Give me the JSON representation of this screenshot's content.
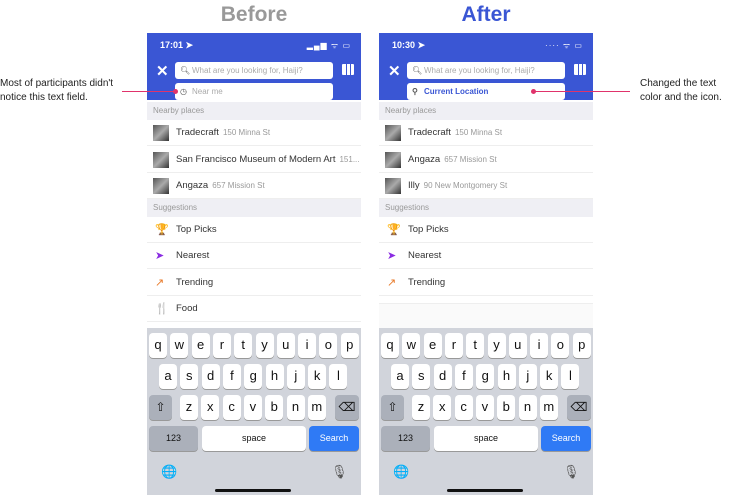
{
  "colors": {
    "header": "#3a56d4",
    "accent": "#e0336b",
    "after_title": "#3a56d4",
    "before_title": "#999999",
    "location_text": "#3a56d4"
  },
  "before": {
    "title": "Before",
    "time": "17:01 ➤",
    "status": "▂▄▆ ᯤ ▭",
    "search_placeholder": "What are you looking for, Haiji?",
    "location_text": "Near me",
    "location_icon": "clock-icon",
    "nearby_label": "Nearby places",
    "nearby": [
      {
        "name": "Tradecraft",
        "addr": "150 Minna St"
      },
      {
        "name": "San Francisco Museum of Modern Art",
        "addr": "151..."
      },
      {
        "name": "Angaza",
        "addr": "657 Mission St"
      }
    ],
    "suggestions_label": "Suggestions",
    "suggestions": [
      {
        "label": "Top Picks",
        "icon": "trophy-icon",
        "glyph": "🏆",
        "color": "#e0446b"
      },
      {
        "label": "Nearest",
        "icon": "location-arrow-icon",
        "glyph": "➤",
        "color": "#8a2be2"
      },
      {
        "label": "Trending",
        "icon": "trending-icon",
        "glyph": "↗",
        "color": "#e87a2a"
      },
      {
        "label": "Food",
        "icon": "fork-knife-icon",
        "glyph": "🍴",
        "color": "#2c46b8"
      }
    ]
  },
  "after": {
    "title": "After",
    "time": "10:30 ➤",
    "status": "···· ᯤ ▭",
    "search_placeholder": "What are you looking for, Haiji?",
    "location_text": "Current Location",
    "location_icon": "pin-icon",
    "nearby_label": "Nearby places",
    "nearby": [
      {
        "name": "Tradecraft",
        "addr": "150 Minna St"
      },
      {
        "name": "Angaza",
        "addr": "657 Mission St"
      },
      {
        "name": "Illy",
        "addr": "90 New Montgomery St"
      }
    ],
    "suggestions_label": "Suggestions",
    "suggestions": [
      {
        "label": "Top Picks",
        "icon": "trophy-icon",
        "glyph": "🏆",
        "color": "#e0446b"
      },
      {
        "label": "Nearest",
        "icon": "location-arrow-icon",
        "glyph": "➤",
        "color": "#8a2be2"
      },
      {
        "label": "Trending",
        "icon": "trending-icon",
        "glyph": "↗",
        "color": "#e87a2a"
      }
    ]
  },
  "keyboard": {
    "row1": [
      "q",
      "w",
      "e",
      "r",
      "t",
      "y",
      "u",
      "i",
      "o",
      "p"
    ],
    "row2": [
      "a",
      "s",
      "d",
      "f",
      "g",
      "h",
      "j",
      "k",
      "l"
    ],
    "row3": [
      "z",
      "x",
      "c",
      "v",
      "b",
      "n",
      "m"
    ],
    "shift": "⇧",
    "delete": "⌫",
    "numbers": "123",
    "space": "space",
    "search": "Search",
    "globe": "🌐",
    "mic": "🎙"
  },
  "annotations": {
    "left": "Most of participants didn't notice this text field.",
    "right": "Changed the text color and the icon."
  }
}
